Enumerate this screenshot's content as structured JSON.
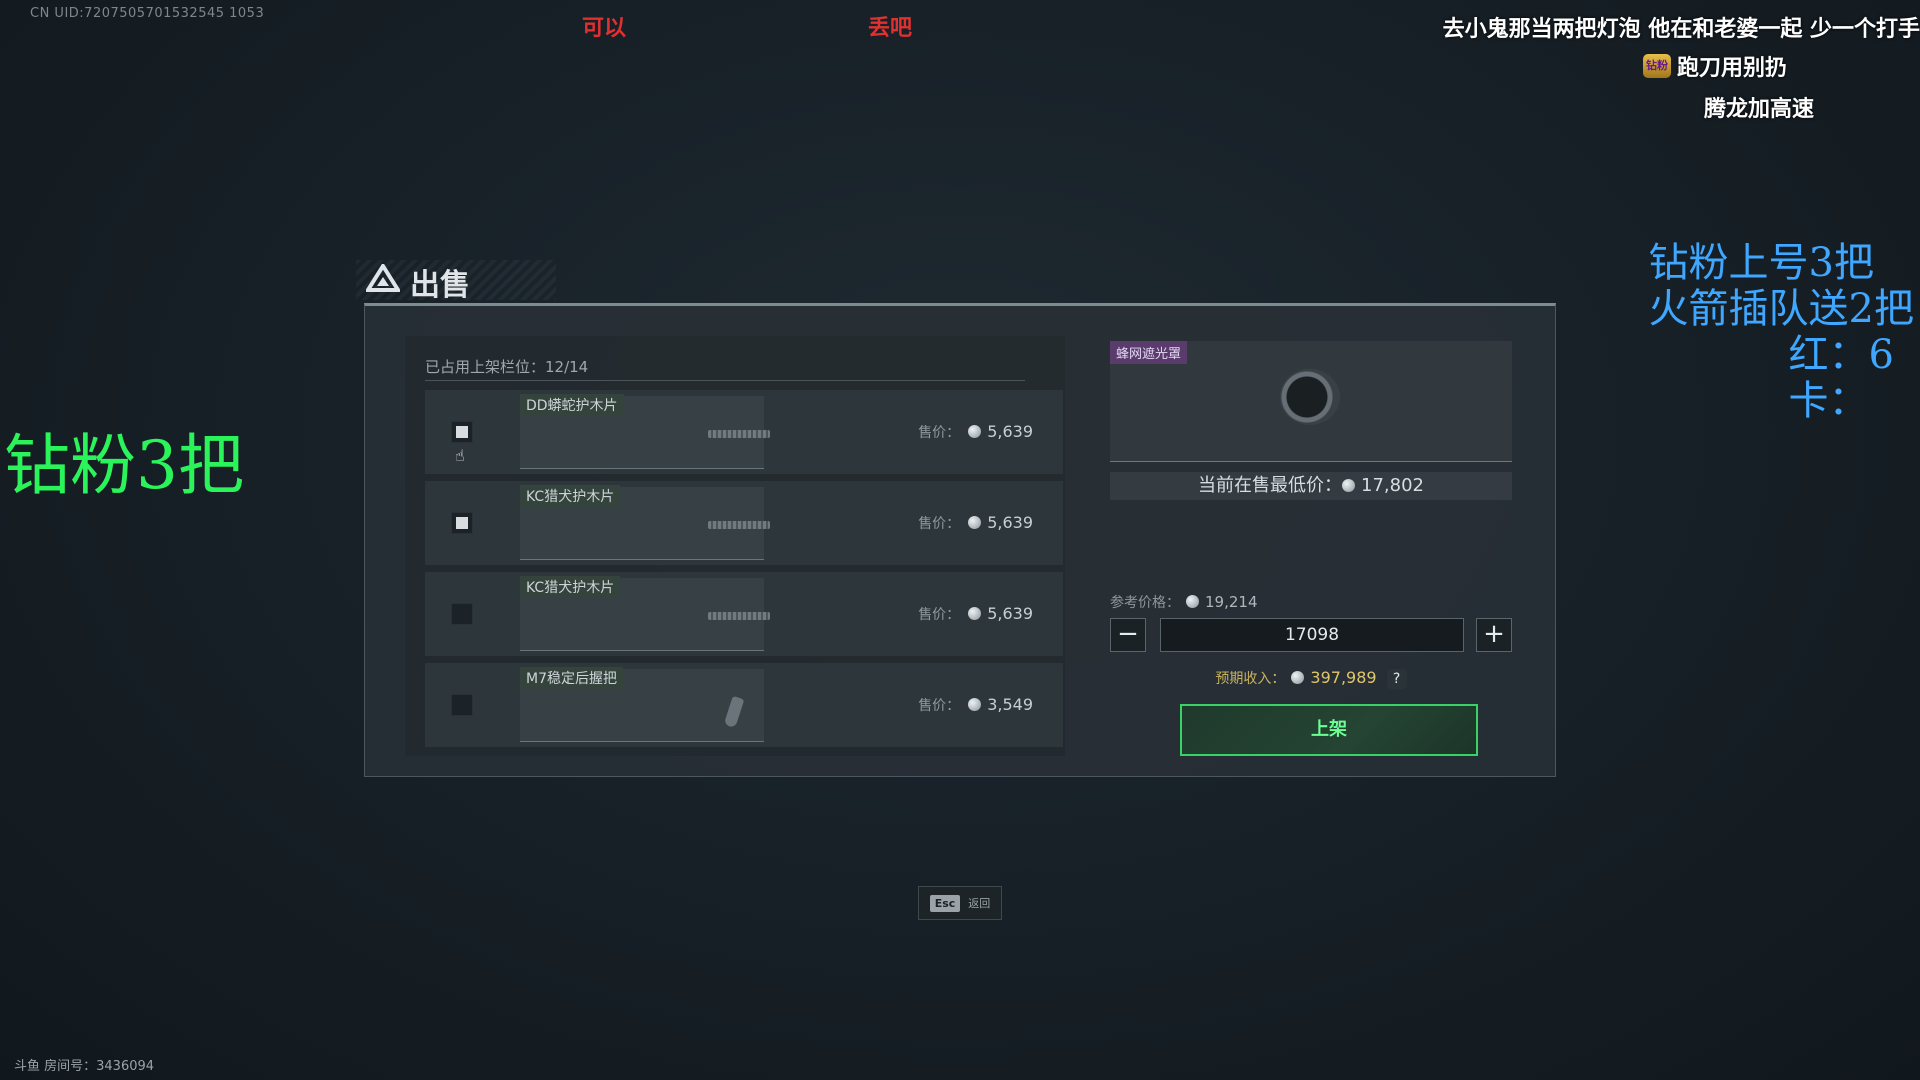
{
  "overlay": {
    "uid": "CN UID:7207505701532545 1053",
    "room": "斗鱼 房间号：3436094",
    "red_notes": [
      "可以",
      "丢吧"
    ],
    "danmu": [
      "去小鬼那当两把灯泡 他在和老婆一起 少一个打手",
      "跑刀用别扔",
      "腾龙加高速"
    ],
    "badge": "钻粉",
    "green_note": "钻粉3把",
    "blue_notes": [
      "钻粉上号3把",
      "火箭插队送2把",
      "红：6",
      "卡："
    ]
  },
  "window": {
    "title": "出售",
    "slots_label": "已占用上架栏位：12/14"
  },
  "items": [
    {
      "name": "DD蟒蛇护木片",
      "price_label": "售价：",
      "price": "5,639",
      "checked": true
    },
    {
      "name": "KC猎犬护木片",
      "price_label": "售价：",
      "price": "5,639",
      "checked": true
    },
    {
      "name": "KC猎犬护木片",
      "price_label": "售价：",
      "price": "5,639",
      "checked": false
    },
    {
      "name": "M7稳定后握把",
      "price_label": "售价：",
      "price": "3,549",
      "checked": false
    }
  ],
  "detail": {
    "item_name": "蜂网遮光罩",
    "lowest_label": "当前在售最低价：",
    "lowest_price": "17,802",
    "ref_label": "参考价格：",
    "ref_price": "19,214",
    "minus": "−",
    "plus": "+",
    "quantity": "17098",
    "income_label": "预期收入：",
    "income": "397,989",
    "help": "?",
    "list_button": "上架"
  },
  "footer": {
    "esc_key": "Esc",
    "esc_label": "返回"
  }
}
